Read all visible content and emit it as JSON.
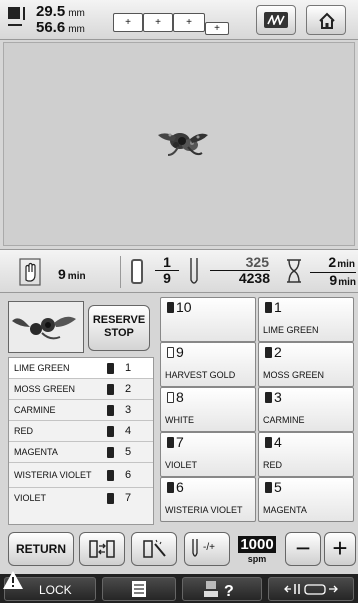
{
  "top": {
    "width_value": "29.5",
    "height_value": "56.6",
    "unit": "mm",
    "frame_labels": [
      "+",
      "+",
      "+",
      "+"
    ]
  },
  "info": {
    "sewing_time": "9",
    "time_unit": "min",
    "color_current": "1",
    "color_total": "9",
    "stitch_current": "325",
    "stitch_total": "4238",
    "remaining_time": "2",
    "total_time": "9"
  },
  "reserve_stop": {
    "line1": "RESERVE",
    "line2": "STOP"
  },
  "sewing_order": [
    {
      "name": "LIME GREEN",
      "needle": "1"
    },
    {
      "name": "MOSS GREEN",
      "needle": "2"
    },
    {
      "name": "CARMINE",
      "needle": "3"
    },
    {
      "name": "RED",
      "needle": "4"
    },
    {
      "name": "MAGENTA",
      "needle": "5"
    },
    {
      "name": "WISTERIA VIOLET",
      "needle": "6"
    },
    {
      "name": "VIOLET",
      "needle": "7"
    }
  ],
  "needle_bars": [
    {
      "number": "10",
      "color_name": "",
      "spool": "filled"
    },
    {
      "number": "1",
      "color_name": "LIME GREEN",
      "spool": "filled"
    },
    {
      "number": "9",
      "color_name": "HARVEST GOLD",
      "spool": "empty"
    },
    {
      "number": "2",
      "color_name": "MOSS GREEN",
      "spool": "filled"
    },
    {
      "number": "8",
      "color_name": "WHITE",
      "spool": "empty"
    },
    {
      "number": "3",
      "color_name": "CARMINE",
      "spool": "filled"
    },
    {
      "number": "7",
      "color_name": "VIOLET",
      "spool": "filled"
    },
    {
      "number": "4",
      "color_name": "RED",
      "spool": "filled"
    },
    {
      "number": "6",
      "color_name": "WISTERIA VIOLET",
      "spool": "filled"
    },
    {
      "number": "5",
      "color_name": "MAGENTA",
      "spool": "filled"
    }
  ],
  "buttons": {
    "return_label": "RETURN",
    "speed_value": "1000",
    "speed_unit": "spm",
    "minus_label": "−",
    "plus_label": "+",
    "speed_adjust_label": "-/+",
    "lock_label": "LOCK"
  },
  "icons": {
    "size": "size-icon",
    "home": "home-icon",
    "pattern": "pattern-icon",
    "hand": "hand-icon",
    "spool": "spool-icon",
    "needle": "needle-icon",
    "hourglass": "hourglass-icon",
    "warning": "warning-icon"
  }
}
